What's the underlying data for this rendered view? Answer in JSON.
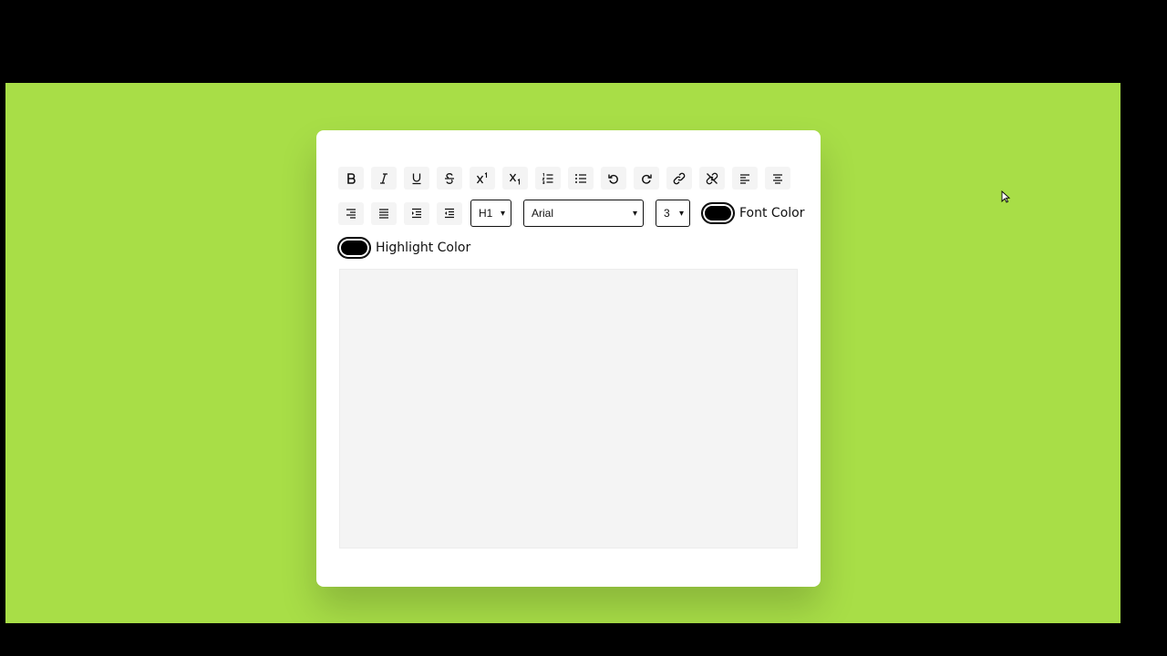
{
  "colors": {
    "page_background": "#000000",
    "stage_background": "#a8de47",
    "card_background": "#ffffff",
    "editor_background": "#f4f4f4",
    "font_color_value": "#000000",
    "highlight_color_value": "#000000"
  },
  "toolbar": {
    "row1": [
      {
        "name": "bold-button",
        "icon": "bold-icon"
      },
      {
        "name": "italic-button",
        "icon": "italic-icon"
      },
      {
        "name": "underline-button",
        "icon": "underline-icon"
      },
      {
        "name": "strikethrough-button",
        "icon": "strikethrough-icon"
      },
      {
        "name": "superscript-button",
        "icon": "superscript-icon"
      },
      {
        "name": "subscript-button",
        "icon": "subscript-icon"
      },
      {
        "name": "ordered-list-button",
        "icon": "ordered-list-icon"
      },
      {
        "name": "unordered-list-button",
        "icon": "unordered-list-icon"
      },
      {
        "name": "undo-button",
        "icon": "undo-icon"
      },
      {
        "name": "redo-button",
        "icon": "redo-icon"
      },
      {
        "name": "create-link-button",
        "icon": "link-icon"
      },
      {
        "name": "unlink-button",
        "icon": "unlink-icon"
      },
      {
        "name": "align-left-button",
        "icon": "align-left-icon"
      },
      {
        "name": "align-center-button",
        "icon": "align-center-icon"
      }
    ],
    "row2": [
      {
        "name": "align-right-button",
        "icon": "align-right-icon"
      },
      {
        "name": "justify-button",
        "icon": "align-justify-icon"
      },
      {
        "name": "indent-button",
        "icon": "indent-icon"
      },
      {
        "name": "outdent-button",
        "icon": "outdent-icon"
      }
    ],
    "heading_select": {
      "value": "H1"
    },
    "font_select": {
      "value": "Arial"
    },
    "size_select": {
      "value": "3"
    },
    "font_color_label": "Font Color",
    "highlight_color_label": "Highlight Color"
  },
  "editor": {
    "content": ""
  }
}
